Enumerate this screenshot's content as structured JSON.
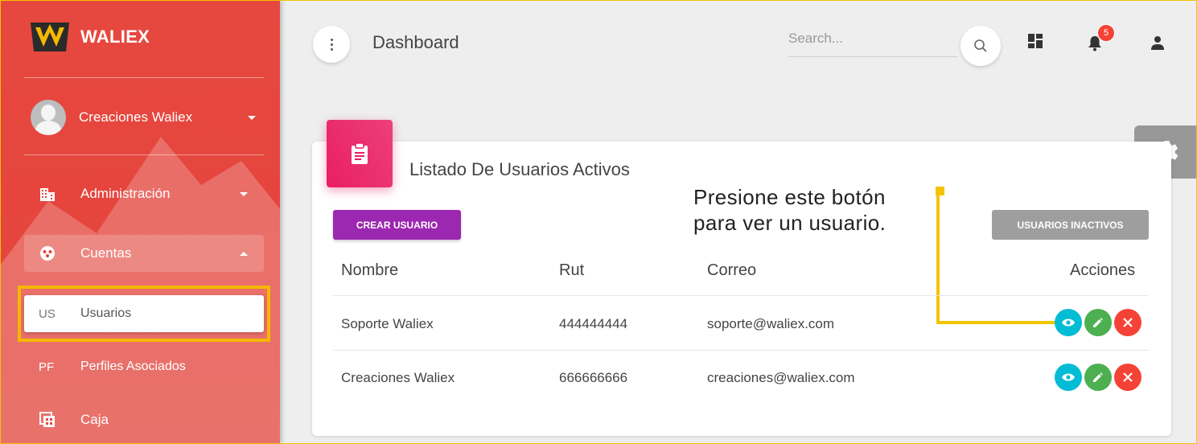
{
  "brand": {
    "name": "WALIEX"
  },
  "sidebar": {
    "user_name": "Creaciones Waliex",
    "items": [
      {
        "label": "Administración"
      },
      {
        "label": "Cuentas"
      },
      {
        "abbr": "US",
        "label": "Usuarios"
      },
      {
        "abbr": "PF",
        "label": "Perfiles Asociados"
      },
      {
        "label": "Caja"
      }
    ]
  },
  "header": {
    "title": "Dashboard",
    "search_placeholder": "Search...",
    "notification_count": "5"
  },
  "card": {
    "title": "Listado De Usuarios Activos",
    "create_button": "CREAR USUARIO",
    "inactive_button": "USUARIOS INACTIVOS",
    "columns": [
      "Nombre",
      "Rut",
      "Correo",
      "Acciones"
    ],
    "rows": [
      {
        "name": "Soporte Waliex",
        "rut": "444444444",
        "email": "soporte@waliex.com"
      },
      {
        "name": "Creaciones Waliex",
        "rut": "666666666",
        "email": "creaciones@waliex.com"
      }
    ]
  },
  "annotation": {
    "line1": "Presione este botón",
    "line2": "para ver un usuario."
  },
  "colors": {
    "sidebar": "#e5453d",
    "primary": "#9c27b0",
    "card_icon": "#e91e63",
    "view": "#00bcd4",
    "edit": "#4caf50",
    "delete": "#f44336",
    "highlight": "#f5b800"
  }
}
